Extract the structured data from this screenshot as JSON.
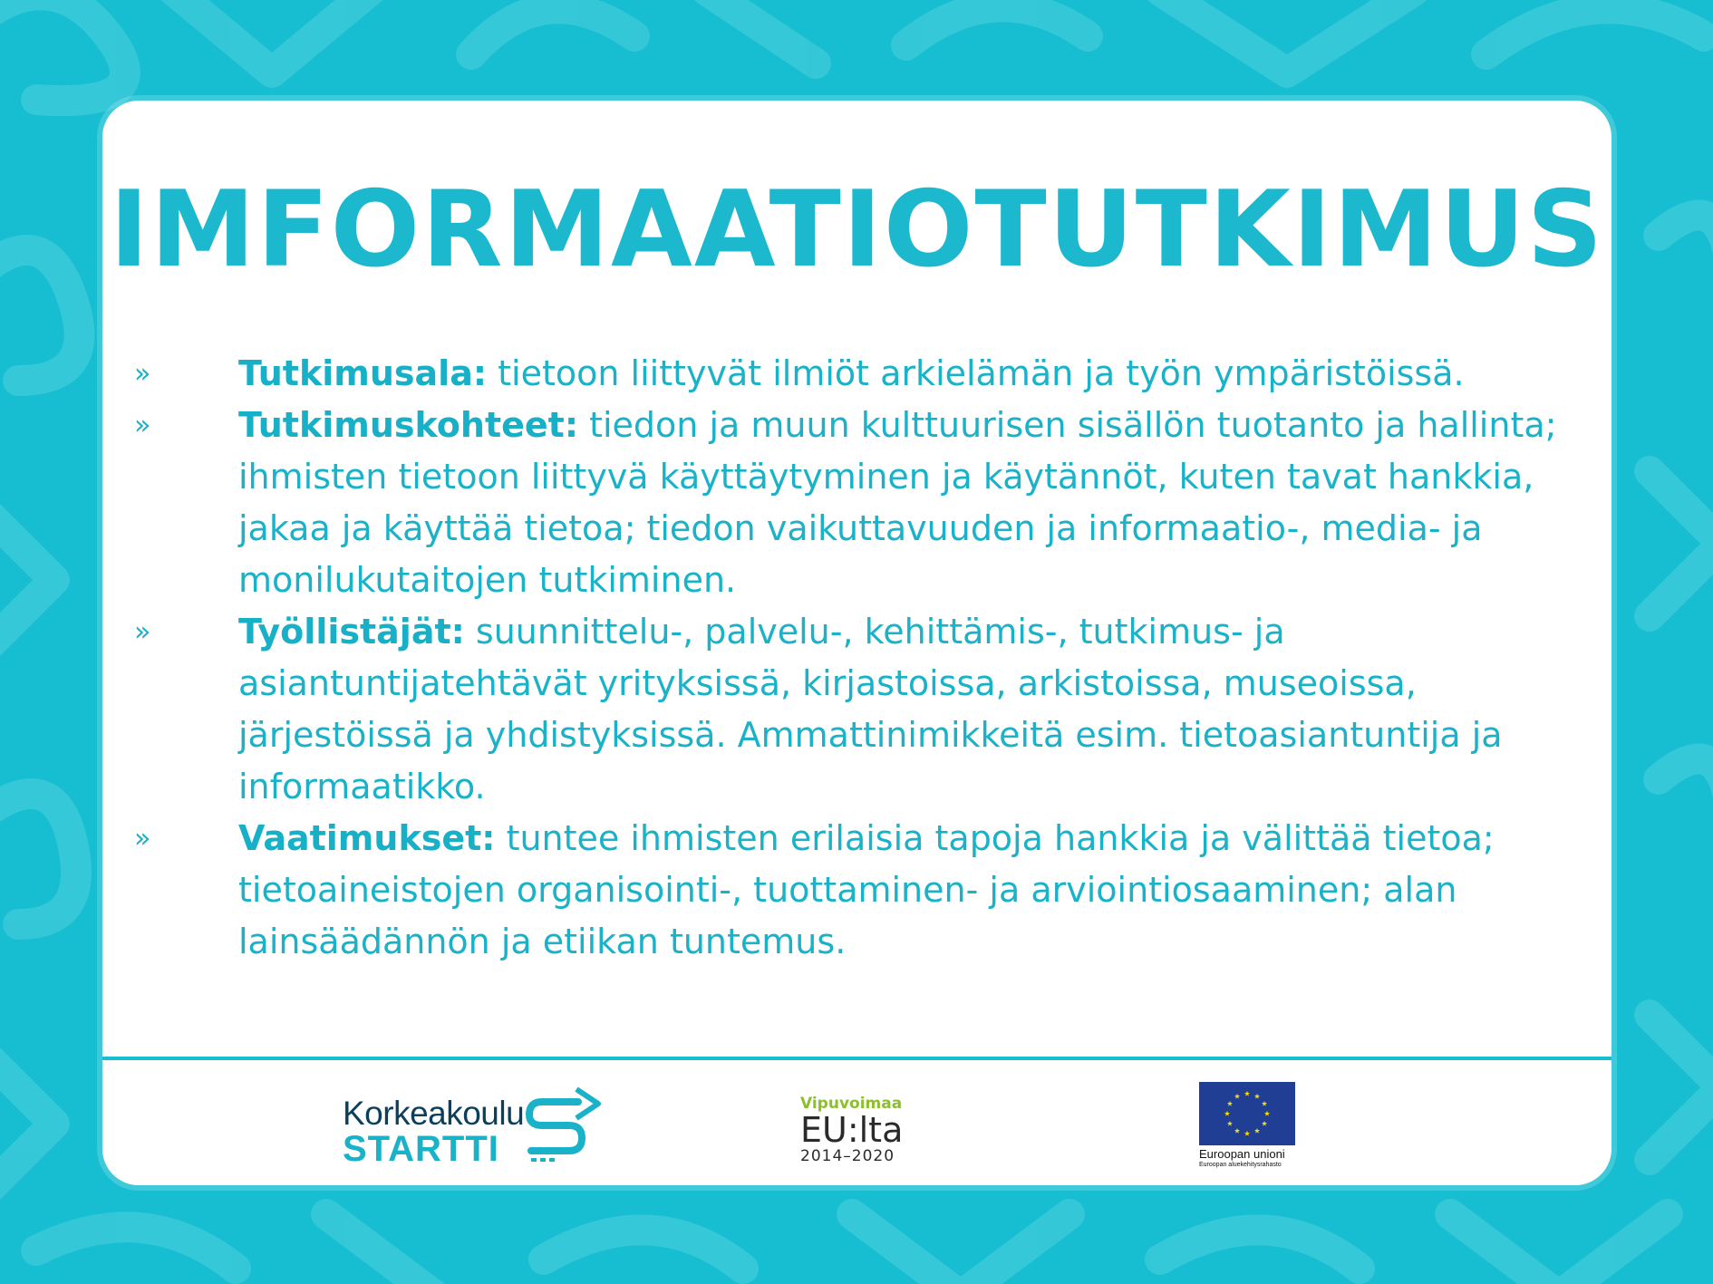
{
  "title": "IMFORMAATIOTUTKIMUS",
  "bullet_glyph": "»",
  "items": [
    {
      "label": "Tutkimusala:",
      "text": " tietoon liittyvät ilmiöt arkielämän ja työn ympäristöissä."
    },
    {
      "label": "Tutkimuskohteet:",
      "text": " tiedon ja muun kulttuurisen sisällön tuotanto ja hallinta; ihmisten tietoon liittyvä käyttäytyminen ja käytännöt, kuten tavat hankkia, jakaa ja käyttää tietoa; tiedon vaikuttavuuden ja informaatio-, media- ja monilukutaitojen tutkiminen."
    },
    {
      "label": "Työllistäjät:",
      "text": " suunnittelu-, palvelu-, kehittämis-, tutkimus- ja asiantuntijatehtävät yrityksissä, kirjastoissa, arkistoissa, museoissa, järjestöissä ja yhdistyksissä. Ammattinimikkeitä esim. tietoasiantuntija ja informaatikko."
    },
    {
      "label": "Vaatimukset:",
      "text": " tuntee ihmisten erilaisia tapoja hankkia ja välittää tietoa; tietoaineistojen organisointi-, tuottaminen- ja arviointiosaaminen; alan lainsäädännön ja etiikan tuntemus."
    }
  ],
  "logos": {
    "startti": {
      "line1": "Korkeakoulu",
      "line2": "STARTTI"
    },
    "vipuvoimaa": {
      "line1": "Vipuvoimaa",
      "line2": "EU:lta",
      "line3": "2014–2020"
    },
    "eu": {
      "line1": "Euroopan unioni",
      "line2": "Euroopan aluekehitysrahasto"
    }
  },
  "colors": {
    "background": "#17bdd0",
    "accent": "#1ab2c8",
    "card": "#ffffff"
  }
}
